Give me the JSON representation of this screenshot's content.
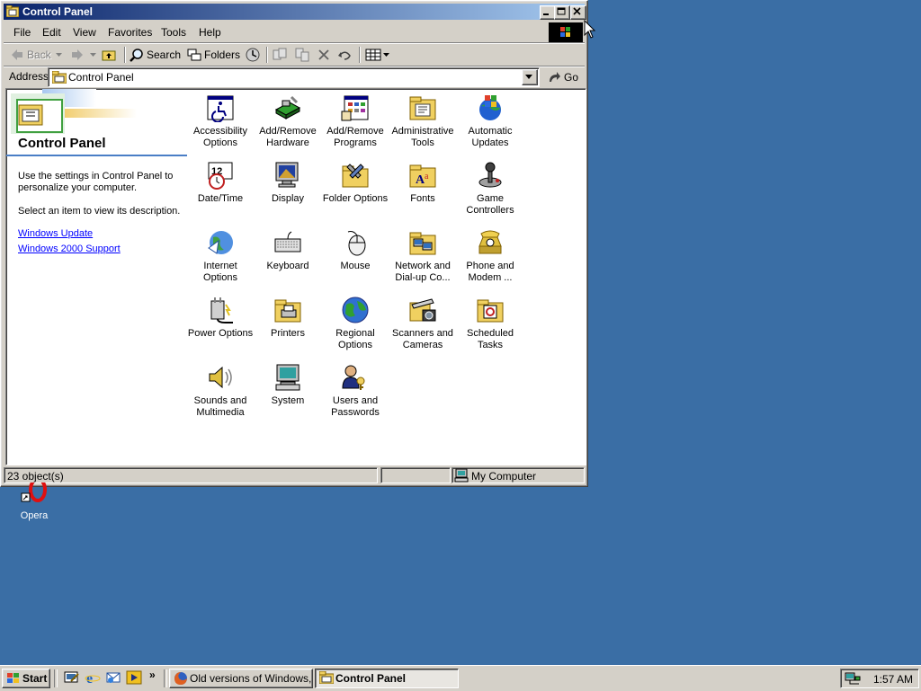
{
  "window": {
    "title": "Control Panel",
    "caption_buttons": [
      "minimize-icon",
      "maximize-icon",
      "close-icon"
    ]
  },
  "menu": [
    "File",
    "Edit",
    "View",
    "Favorites",
    "Tools",
    "Help"
  ],
  "toolbar": {
    "back": "Back",
    "search": "Search",
    "folders": "Folders"
  },
  "address": {
    "label": "Address",
    "value": "Control Panel",
    "go": "Go"
  },
  "leftpane": {
    "title": "Control Panel",
    "description": "Use the settings in Control Panel to personalize your computer.",
    "hint": "Select an item to view its description.",
    "links": [
      "Windows Update",
      "Windows 2000 Support"
    ]
  },
  "items": [
    {
      "label": "Accessibility Options",
      "icon": "accessibility-icon"
    },
    {
      "label": "Add/Remove Hardware",
      "icon": "hardware-icon"
    },
    {
      "label": "Add/Remove Programs",
      "icon": "programs-icon"
    },
    {
      "label": "Administrative Tools",
      "icon": "admin-tools-icon"
    },
    {
      "label": "Automatic Updates",
      "icon": "windows-update-icon"
    },
    {
      "label": "Date/Time",
      "icon": "clock-icon"
    },
    {
      "label": "Display",
      "icon": "monitor-icon"
    },
    {
      "label": "Folder Options",
      "icon": "folder-options-icon"
    },
    {
      "label": "Fonts",
      "icon": "fonts-folder-icon"
    },
    {
      "label": "Game Controllers",
      "icon": "joystick-icon"
    },
    {
      "label": "Internet Options",
      "icon": "globe-icon"
    },
    {
      "label": "Keyboard",
      "icon": "keyboard-icon"
    },
    {
      "label": "Mouse",
      "icon": "mouse-icon"
    },
    {
      "label": "Network and Dial-up Co...",
      "icon": "network-folder-icon"
    },
    {
      "label": "Phone and Modem ...",
      "icon": "phone-icon"
    },
    {
      "label": "Power Options",
      "icon": "power-plug-icon"
    },
    {
      "label": "Printers",
      "icon": "printer-folder-icon"
    },
    {
      "label": "Regional Options",
      "icon": "earth-icon"
    },
    {
      "label": "Scanners and Cameras",
      "icon": "scanner-icon"
    },
    {
      "label": "Scheduled Tasks",
      "icon": "scheduled-tasks-icon"
    },
    {
      "label": "Sounds and Multimedia",
      "icon": "speaker-icon"
    },
    {
      "label": "System",
      "icon": "computer-icon"
    },
    {
      "label": "Users and Passwords",
      "icon": "users-icon"
    }
  ],
  "status": {
    "objects": "23 object(s)",
    "zone": "My Computer"
  },
  "desktop": {
    "opera_label": "Opera"
  },
  "taskbar": {
    "start": "Start",
    "tasks": [
      "Old versions of Windows, ...",
      "Control Panel"
    ],
    "active_task": "Control Panel",
    "clock": "1:57 AM",
    "overflow": "»"
  },
  "colors": {
    "desktop": "#3a6ea5",
    "title_active": "#0a246a",
    "face": "#d4d0c8",
    "link": "#0000ff"
  }
}
